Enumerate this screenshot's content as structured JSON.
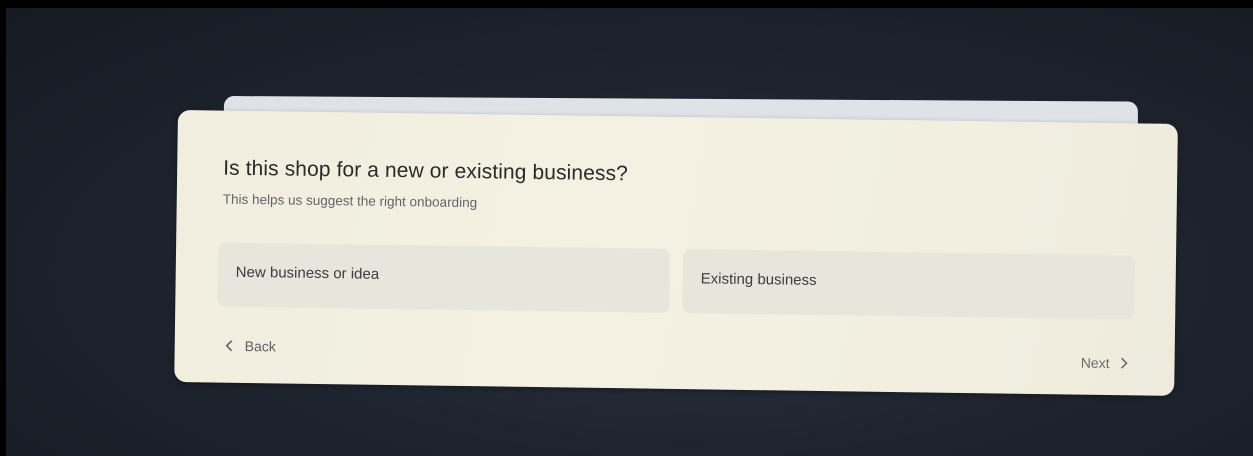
{
  "dialog": {
    "title": "Is this shop for a new or existing business?",
    "subtitle": "This helps us suggest the right onboarding",
    "options": [
      {
        "label": "New business or idea"
      },
      {
        "label": "Existing business"
      }
    ],
    "back_label": "Back",
    "next_label": "Next"
  },
  "icons": {
    "back": "chevron-left-icon",
    "next": "chevron-right-icon"
  }
}
